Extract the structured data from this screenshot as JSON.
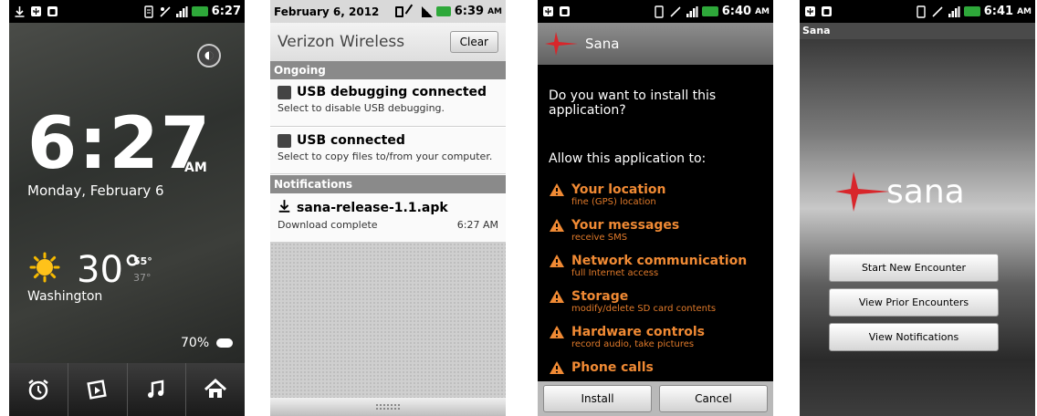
{
  "phone1": {
    "status": {
      "time": "6:27",
      "ampm": "AM"
    },
    "clock": {
      "time": "6:27",
      "ampm": "AM"
    },
    "date": "Monday, February 6",
    "weather": {
      "temp": "30°",
      "high": "55°",
      "low": "37°",
      "city": "Washington"
    },
    "battery": "70%",
    "dock": [
      "alarm-clock-icon",
      "gallery-icon",
      "music-icon",
      "home-icon"
    ]
  },
  "phone2": {
    "status": {
      "date": "February 6, 2012",
      "time": "6:39",
      "ampm": "AM"
    },
    "carrier": "Verizon Wireless",
    "clear_label": "Clear",
    "sections": {
      "ongoing": "Ongoing",
      "notifications": "Notifications"
    },
    "items": [
      {
        "title": "USB debugging connected",
        "subtitle": "Select to disable USB debugging.",
        "time": ""
      },
      {
        "title": "USB connected",
        "subtitle": "Select to copy files to/from your computer.",
        "time": ""
      },
      {
        "title": "sana-release-1.1.apk",
        "subtitle": "Download complete",
        "time": "6:27 AM"
      }
    ]
  },
  "phone3": {
    "status": {
      "time": "6:40",
      "ampm": "AM"
    },
    "app_name": "Sana",
    "question": "Do you want to install this application?",
    "allow": "Allow this application to:",
    "permissions": [
      {
        "title": "Your location",
        "desc": "fine (GPS) location"
      },
      {
        "title": "Your messages",
        "desc": "receive SMS"
      },
      {
        "title": "Network communication",
        "desc": "full Internet access"
      },
      {
        "title": "Storage",
        "desc": "modify/delete SD card contents"
      },
      {
        "title": "Hardware controls",
        "desc": "record audio, take pictures"
      },
      {
        "title": "Phone calls",
        "desc": ""
      }
    ],
    "install_label": "Install",
    "cancel_label": "Cancel",
    "accent": "#f08a34"
  },
  "phone4": {
    "status": {
      "time": "6:41",
      "ampm": "AM"
    },
    "title": "Sana",
    "logo_text": "sana",
    "buttons": [
      "Start New Encounter",
      "View Prior Encounters",
      "View Notifications"
    ],
    "brand_color": "#d8262b"
  }
}
